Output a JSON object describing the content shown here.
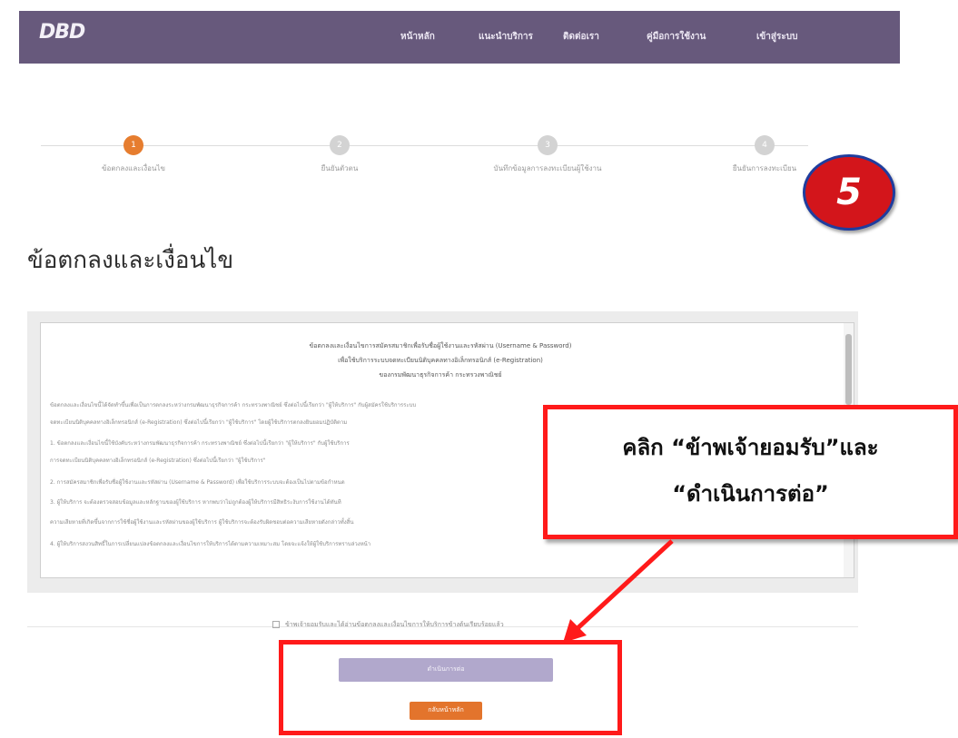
{
  "header": {
    "logo": "DBD",
    "nav": [
      "หน้าหลัก",
      "แนะนำบริการ",
      "ติดต่อเรา",
      "คู่มือการใช้งาน",
      "เข้าสู่ระบบ"
    ]
  },
  "stepper": {
    "steps": [
      {
        "number": "1",
        "label": "ข้อตกลงและเงื่อนไข",
        "state": "active"
      },
      {
        "number": "2",
        "label": "ยืนยันตัวตน",
        "state": "inactive"
      },
      {
        "number": "3",
        "label": "บันทึกข้อมูลการลงทะเบียนผู้ใช้งาน",
        "state": "inactive"
      },
      {
        "number": "4",
        "label": "ยืนยันการลงทะเบียน",
        "state": "inactive"
      }
    ]
  },
  "annotation": {
    "step_badge": "5",
    "callout_line1": "คลิก “ข้าพเจ้ายอมรับ”และ",
    "callout_line2": "“ดำเนินการต่อ”"
  },
  "page": {
    "title": "ข้อตกลงและเงื่อนไข"
  },
  "terms": {
    "heading_lines": [
      "ข้อตกลงและเงื่อนไขการสมัครสมาชิกเพื่อรับชื่อผู้ใช้งานและรหัสผ่าน (Username & Password)",
      "เพื่อใช้บริการระบบจดทะเบียนนิติบุคคลทางอิเล็กทรอนิกส์ (e-Registration)",
      "ของกรมพัฒนาธุรกิจการค้า กระทรวงพาณิชย์"
    ],
    "paragraphs": [
      "ข้อตกลงและเงื่อนไขนี้ได้จัดทำขึ้นเพื่อเป็นการตกลงระหว่างกรมพัฒนาธุรกิจการค้า กระทรวงพาณิชย์ ซึ่งต่อไปนี้เรียกว่า \"ผู้ให้บริการ\" กับผู้สมัครใช้บริการระบบ",
      "จดทะเบียนนิติบุคคลทางอิเล็กทรอนิกส์ (e-Registration) ซึ่งต่อไปนี้เรียกว่า \"ผู้ใช้บริการ\" โดยผู้ใช้บริการตกลงยินยอมปฏิบัติตาม",
      "1. ข้อตกลงและเงื่อนไขนี้ใช้บังคับระหว่างกรมพัฒนาธุรกิจการค้า กระทรวงพาณิชย์ ซึ่งต่อไปนี้เรียกว่า \"ผู้ให้บริการ\" กับผู้ใช้บริการ",
      "การจดทะเบียนนิติบุคคลทางอิเล็กทรอนิกส์ (e-Registration) ซึ่งต่อไปนี้เรียกว่า \"ผู้ใช้บริการ\"",
      "2. การสมัครสมาชิกเพื่อรับชื่อผู้ใช้งานและรหัสผ่าน (Username & Password) เพื่อใช้บริการระบบจะต้องเป็นไปตามข้อกำหนด",
      "3. ผู้ให้บริการ จะต้องตรวจสอบข้อมูลและหลักฐานของผู้ใช้บริการ หากพบว่าไม่ถูกต้องผู้ให้บริการมีสิทธิระงับการใช้งานได้ทันที",
      "ความเสียหายที่เกิดขึ้นจากการใช้ชื่อผู้ใช้งานและรหัสผ่านของผู้ใช้บริการ ผู้ใช้บริการจะต้องรับผิดชอบต่อความเสียหายดังกล่าวทั้งสิ้น",
      "4. ผู้ให้บริการสงวนสิทธิ์ในการเปลี่ยนแปลงข้อตกลงและเงื่อนไขการให้บริการได้ตามความเหมาะสม โดยจะแจ้งให้ผู้ใช้บริการทราบล่วงหน้า"
    ]
  },
  "consent": {
    "label": "ข้าพเจ้ายอมรับและได้อ่านข้อตกลงและเงื่อนไขการให้บริการข้างต้นเรียบร้อยแล้ว"
  },
  "actions": {
    "continue_label": "ดำเนินการต่อ",
    "back_label": "กลับหน้าหลัก"
  },
  "colors": {
    "header_bg": "#67597c",
    "step_active": "#e67d2f",
    "button_continue": "#b1a8cc",
    "button_back": "#e3742c",
    "annotation_red": "#ff1a1a"
  }
}
